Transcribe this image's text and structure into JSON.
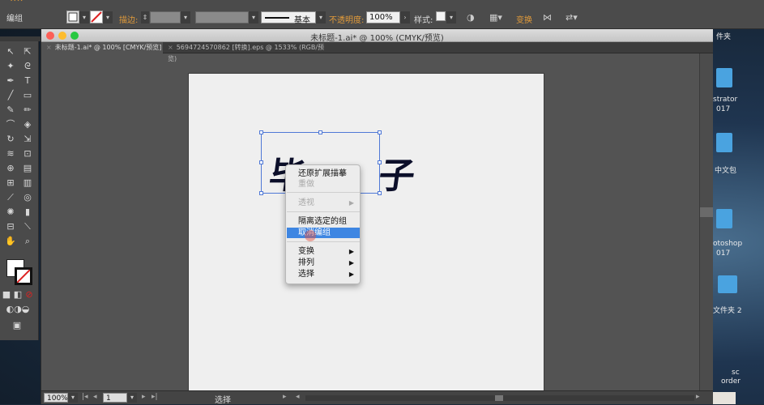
{
  "control_bar": {
    "group_label": "编组",
    "stroke_label": "描边:",
    "profile_label": "基本",
    "opacity_label": "不透明度:",
    "opacity_value": "100%",
    "style_label": "样式:",
    "transform_label": "变换"
  },
  "window": {
    "title": "未标题-1.ai* @ 100% (CMYK/预览)",
    "tabs": [
      {
        "label": "未标题-1.ai* @ 100% [CMYK/预览]",
        "active": true
      },
      {
        "label": "5694724570862 [转换].eps @ 1533% (RGB/预览)",
        "active": false
      }
    ]
  },
  "artwork": {
    "calligraphy_text": "毕 子"
  },
  "context_menu": {
    "items": [
      {
        "label": "还原扩展描摹",
        "state": "enabled",
        "submenu": false
      },
      {
        "label": "重做",
        "state": "disabled",
        "submenu": false
      },
      {
        "label": "透视",
        "state": "disabled",
        "submenu": true
      },
      {
        "label": "隔离选定的组",
        "state": "enabled",
        "submenu": false
      },
      {
        "label": "取消编组",
        "state": "highlighted",
        "submenu": false
      },
      {
        "label": "变换",
        "state": "enabled",
        "submenu": true
      },
      {
        "label": "排列",
        "state": "enabled",
        "submenu": true
      },
      {
        "label": "选择",
        "state": "enabled",
        "submenu": true
      }
    ]
  },
  "status_bar": {
    "zoom": "100%",
    "artboard_number": "1",
    "tool_name": "选择"
  },
  "desktop": {
    "labels": [
      "件夹",
      "strator",
      "017",
      "中文包",
      "otoshop",
      "017",
      "文件夹 2",
      "sc",
      "order"
    ]
  },
  "colors": {
    "selection": "#4f78d6",
    "menu_highlight": "#3e86e2",
    "accent_label": "#e29b3a"
  }
}
